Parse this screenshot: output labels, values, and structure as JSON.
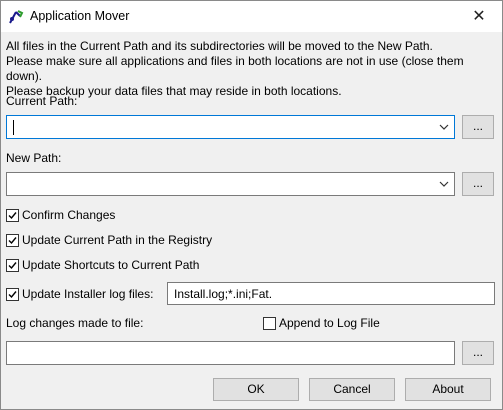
{
  "window": {
    "title": "Application Mover",
    "close_glyph": "✕"
  },
  "info_lines": [
    "All files in the Current Path and its subdirectories will be moved to the New Path.",
    "Please make sure all applications and files in both locations are not in use (close them down).",
    "Please backup your data files that may reside in both locations."
  ],
  "current_path": {
    "label": "Current Path:",
    "value": "",
    "browse_label": "..."
  },
  "new_path": {
    "label": "New Path:",
    "value": "",
    "browse_label": "..."
  },
  "options": {
    "confirm_changes": {
      "label": "Confirm Changes",
      "checked": true
    },
    "update_registry": {
      "label": "Update Current Path in the Registry",
      "checked": true
    },
    "update_shortcuts": {
      "label": "Update Shortcuts to Current Path",
      "checked": true
    },
    "update_installer_logs": {
      "label": "Update Installer log files:",
      "checked": true,
      "value": "Install.log;*.ini;Fat."
    }
  },
  "log_file": {
    "label": "Log changes made to file:",
    "append_label": "Append to Log File",
    "append_checked": false,
    "value": "",
    "browse_label": "..."
  },
  "buttons": {
    "ok": "OK",
    "cancel": "Cancel",
    "about": "About"
  },
  "colors": {
    "focus_border": "#0078d7",
    "button_face": "#e1e1e1"
  }
}
